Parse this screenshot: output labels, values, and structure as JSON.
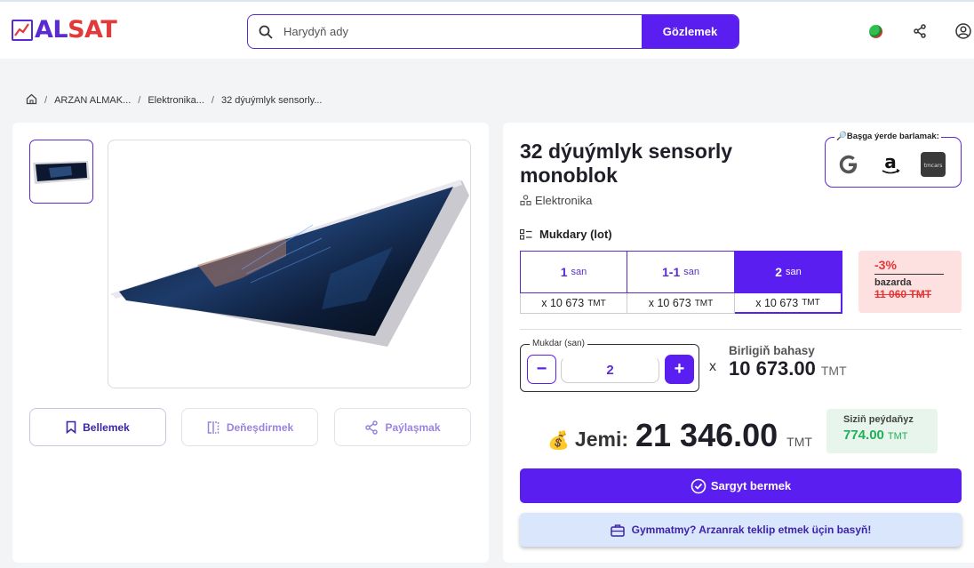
{
  "header": {
    "logo": {
      "part1": "AL",
      "part2": "SAT"
    },
    "search": {
      "placeholder": "Harydyň ady",
      "button_label": "Gözlemek"
    },
    "icons": [
      "globe-icon",
      "share-icon",
      "user-icon"
    ]
  },
  "breadcrumb": {
    "items": [
      "ARZAN ALMAK...",
      "Elektronika...",
      "32 dýuýmlyk sensorly..."
    ]
  },
  "gallery": {
    "actions": {
      "save_label": "Bellemek",
      "compare_label": "Deňeşdirmek",
      "share_label": "Paýlaşmak"
    }
  },
  "product": {
    "title": "32 dýuýmlyk sensorly monoblok",
    "category": "Elektronika",
    "elsewhere_label": "🔎Başga ýerde barlamak:",
    "elsewhere_sources": [
      "google-icon",
      "amazon-icon",
      "tmcars-icon"
    ],
    "quantity_label": "Mukdary (lot)",
    "lots": [
      {
        "count": "1",
        "unit": "san",
        "price": "x 10 673",
        "currency": "TMT",
        "active": false
      },
      {
        "count": "1-1",
        "unit": "san",
        "price": "x 10 673",
        "currency": "TMT",
        "active": false
      },
      {
        "count": "2",
        "unit": "san",
        "price": "x 10 673",
        "currency": "TMT",
        "active": true
      }
    ],
    "discount": {
      "percent": "-3%",
      "label": "bazarda",
      "old_price": "11 060 TMT"
    },
    "stepper": {
      "label": "Mukdar (san)",
      "value": "2",
      "minus": "−",
      "plus": "+"
    },
    "times": "x",
    "unit_price_label": "Birligiň bahasy",
    "unit_price": "10 673.00",
    "currency": "TMT",
    "total_label": "Jemi:",
    "total_value": "21 346.00",
    "profit_label": "Siziň peýdaňyz",
    "profit_value": "774.00",
    "order_label": "Sargyt bermek",
    "offer_label": "Gymmatmy? Arzanrak teklip etmek üçin basyň!"
  },
  "colors": {
    "primary": "#5a1ef0",
    "brand_red": "#e23a3a",
    "discount_red": "#e53535",
    "profit_green": "#1fb055"
  }
}
